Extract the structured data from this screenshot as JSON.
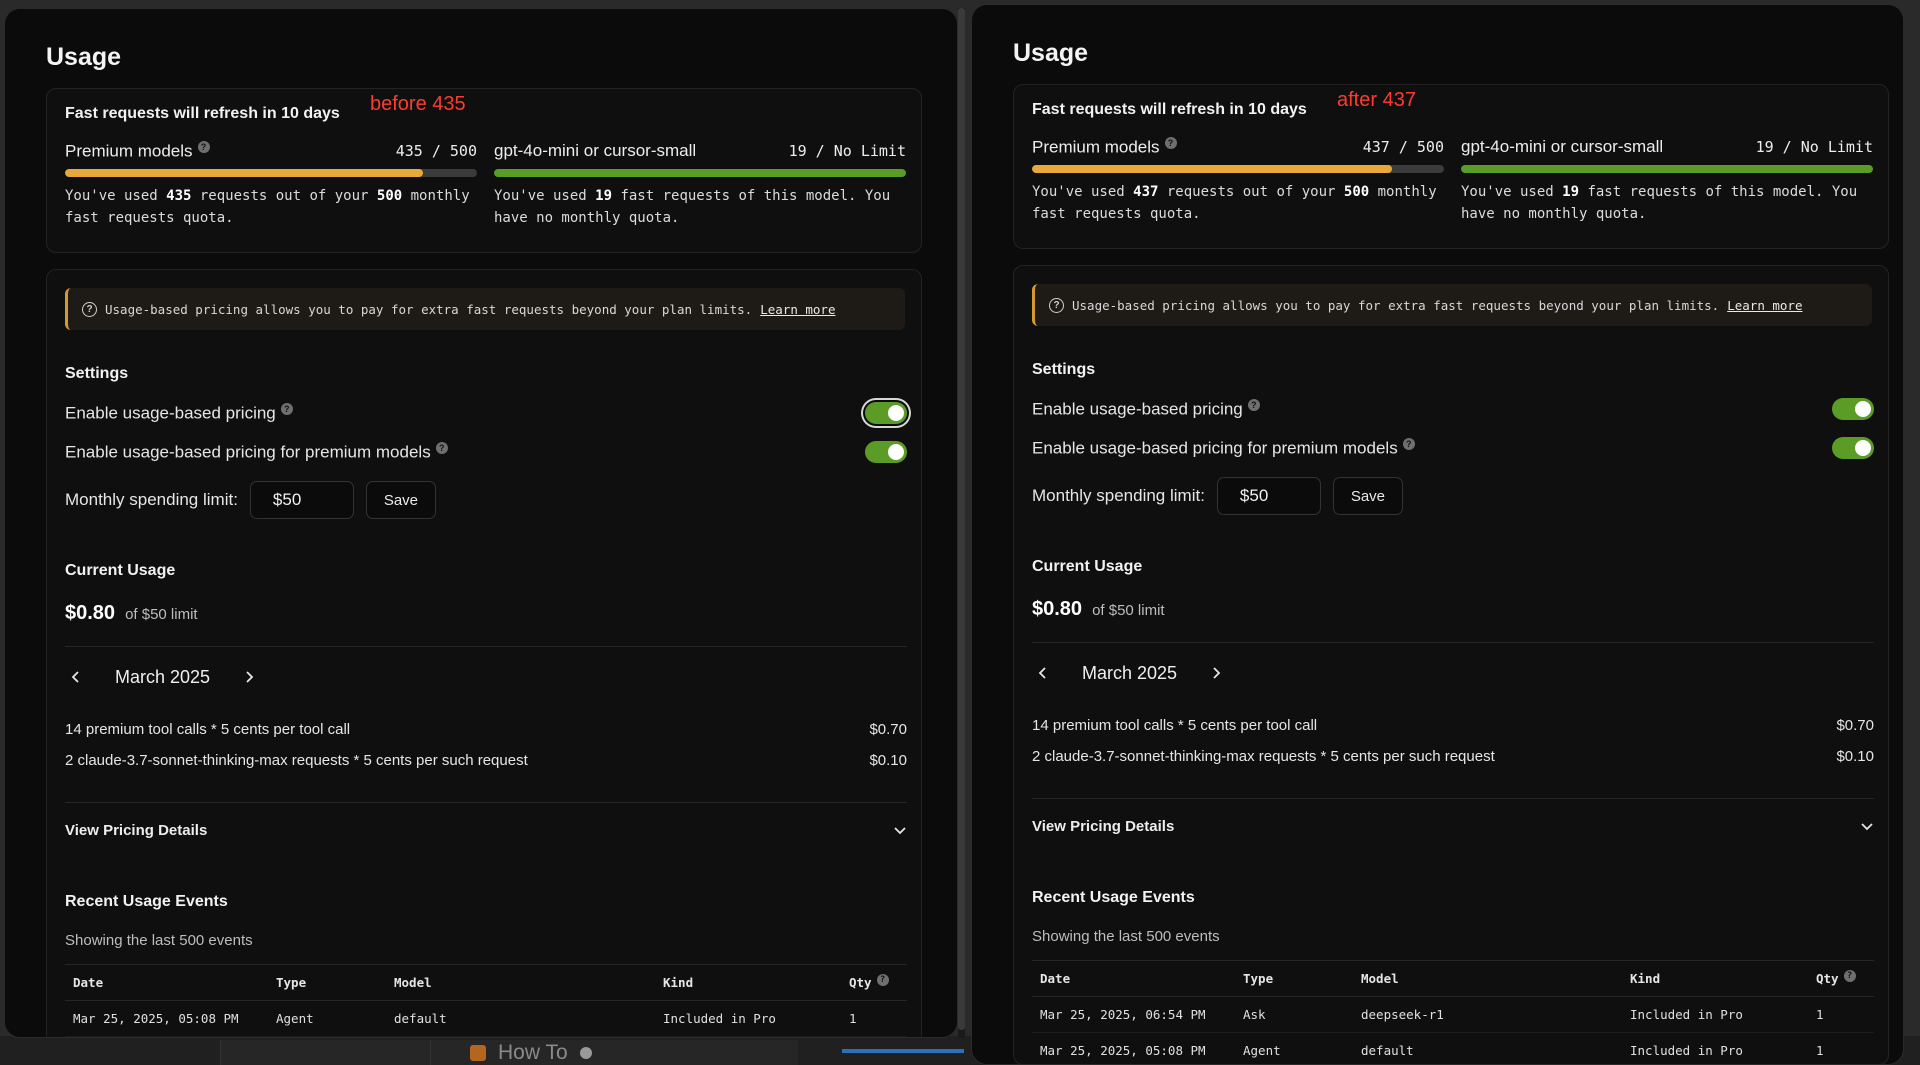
{
  "panels": [
    {
      "title": "Usage",
      "annotation": "before 435",
      "refresh_title": "Fast requests will refresh in 10 days",
      "premium": {
        "label": "Premium models",
        "count": "435 / 500",
        "progress": 0.87,
        "desc_pre": "You've used ",
        "used": "435",
        "desc_mid": " requests out of your ",
        "quota": "500",
        "desc_post": " monthly fast requests quota."
      },
      "mini": {
        "label": "gpt-4o-mini or cursor-small",
        "count": "19 / No Limit",
        "progress": 1.0,
        "desc_pre": "You've used ",
        "used": "19",
        "desc_post": " fast requests of this model. You have no monthly quota."
      },
      "info_text": "Usage-based pricing allows you to pay for extra fast requests beyond your plan limits.",
      "info_link": "Learn more",
      "settings_title": "Settings",
      "setting1": "Enable usage-based pricing",
      "setting2": "Enable usage-based pricing for premium models",
      "limit_label": "Monthly spending limit:",
      "limit_value": "$50",
      "save_label": "Save",
      "current_title": "Current Usage",
      "spent": "$0.80",
      "spent_limit": "of $50 limit",
      "month": "March 2025",
      "charges": [
        {
          "desc": "14 premium tool calls * 5 cents per tool call",
          "amount": "$0.70"
        },
        {
          "desc": "2 claude-3.7-sonnet-thinking-max requests * 5 cents per such request",
          "amount": "$0.10"
        }
      ],
      "pricing_details": "View Pricing Details",
      "events_title": "Recent Usage Events",
      "events_sub": "Showing the last 500 events",
      "columns": [
        "Date",
        "Type",
        "Model",
        "Kind",
        "Qty"
      ],
      "rows": [
        [
          "Mar 25, 2025, 05:08 PM",
          "Agent",
          "default",
          "Included in Pro",
          "1"
        ]
      ]
    },
    {
      "title": "Usage",
      "annotation": "after 437",
      "refresh_title": "Fast requests will refresh in 10 days",
      "premium": {
        "label": "Premium models",
        "count": "437 / 500",
        "progress": 0.874,
        "desc_pre": "You've used ",
        "used": "437",
        "desc_mid": " requests out of your ",
        "quota": "500",
        "desc_post": " monthly fast requests quota."
      },
      "mini": {
        "label": "gpt-4o-mini or cursor-small",
        "count": "19 / No Limit",
        "progress": 1.0,
        "desc_pre": "You've used ",
        "used": "19",
        "desc_post": " fast requests of this model. You have no monthly quota."
      },
      "info_text": "Usage-based pricing allows you to pay for extra fast requests beyond your plan limits.",
      "info_link": "Learn more",
      "settings_title": "Settings",
      "setting1": "Enable usage-based pricing",
      "setting2": "Enable usage-based pricing for premium models",
      "limit_label": "Monthly spending limit:",
      "limit_value": "$50",
      "save_label": "Save",
      "current_title": "Current Usage",
      "spent": "$0.80",
      "spent_limit": "of $50 limit",
      "month": "March 2025",
      "charges": [
        {
          "desc": "14 premium tool calls * 5 cents per tool call",
          "amount": "$0.70"
        },
        {
          "desc": "2 claude-3.7-sonnet-thinking-max requests * 5 cents per such request",
          "amount": "$0.10"
        }
      ],
      "pricing_details": "View Pricing Details",
      "events_title": "Recent Usage Events",
      "events_sub": "Showing the last 500 events",
      "columns": [
        "Date",
        "Type",
        "Model",
        "Kind",
        "Qty"
      ],
      "rows": [
        [
          "Mar 25, 2025, 06:54 PM",
          "Ask",
          "deepseek-r1",
          "Included in Pro",
          "1"
        ],
        [
          "Mar 25, 2025, 05:08 PM",
          "Agent",
          "default",
          "Included in Pro",
          "1"
        ]
      ]
    }
  ],
  "taskbar": {
    "tab_label": "How To"
  },
  "colors": {
    "premium_bar": "#e6a93a",
    "mini_bar": "#5a9c25",
    "toggle_on": "#5a9c25",
    "annotation": "#ff3b30"
  }
}
